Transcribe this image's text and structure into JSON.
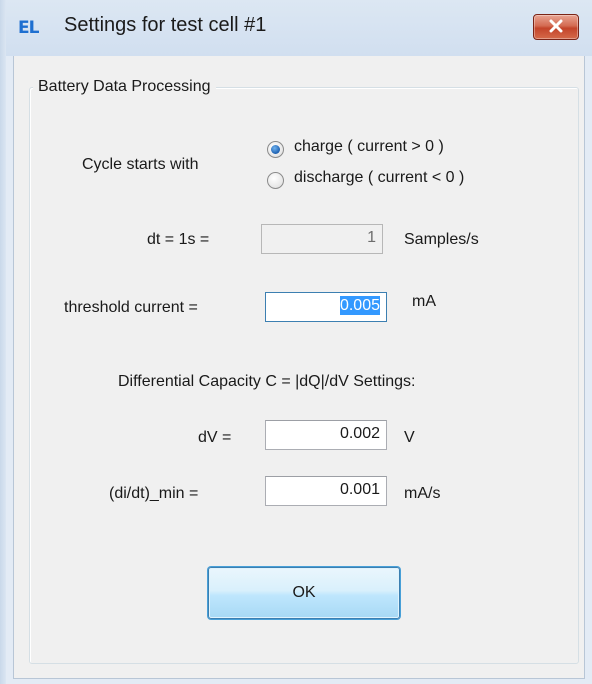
{
  "window": {
    "title": "Settings for test cell #1",
    "app_icon_text": "EL",
    "app_icon_color": "#1e6fd0"
  },
  "group": {
    "title": "Battery Data Processing"
  },
  "cycle": {
    "label": "Cycle starts with",
    "options": [
      {
        "label": "charge ( current > 0 )",
        "checked": true
      },
      {
        "label": "discharge ( current < 0 )",
        "checked": false
      }
    ]
  },
  "dt": {
    "label": "dt = 1s =",
    "value": "1",
    "unit": "Samples/s"
  },
  "threshold": {
    "label": "threshold current =",
    "value": "0.005",
    "unit": "mA"
  },
  "diffcap": {
    "heading": "Differential Capacity C = |dQ|/dV Settings:",
    "dv": {
      "label": "dV =",
      "value": "0.002",
      "unit": "V"
    },
    "didt": {
      "label": "(di/dt)_min =",
      "value": "0.001",
      "unit": "mA/s"
    }
  },
  "ok_button": {
    "label": "OK"
  },
  "colors": {
    "title_bg": "#d1dff0",
    "close_button": "#c3442a",
    "selection": "#3399ff",
    "button_border": "#3c7fb1"
  }
}
